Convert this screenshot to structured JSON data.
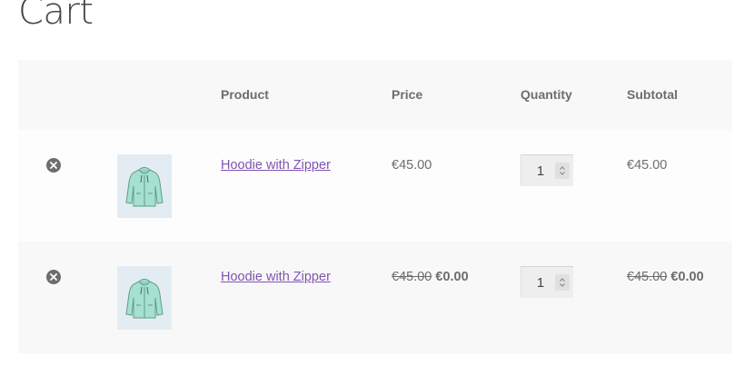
{
  "page": {
    "title": "Cart"
  },
  "table": {
    "headers": {
      "product": "Product",
      "price": "Price",
      "quantity": "Quantity",
      "subtotal": "Subtotal"
    },
    "rows": [
      {
        "product_name": "Hoodie with Zipper",
        "price": "€45.00",
        "price_original": "",
        "quantity": "1",
        "subtotal": "€45.00",
        "subtotal_original": ""
      },
      {
        "product_name": "Hoodie with Zipper",
        "price": "€0.00",
        "price_original": "€45.00",
        "quantity": "1",
        "subtotal": "€0.00",
        "subtotal_original": "€45.00"
      }
    ]
  },
  "icons": {
    "remove": "remove-circle-x-icon",
    "stepper": "up-down-chevron-icon"
  },
  "colors": {
    "link": "#7f54b3",
    "text": "#6d6d6d",
    "header_bg": "#f8f8f8",
    "thumb_bg": "#e3ecf2",
    "hoodie": "#a6e0cf"
  }
}
